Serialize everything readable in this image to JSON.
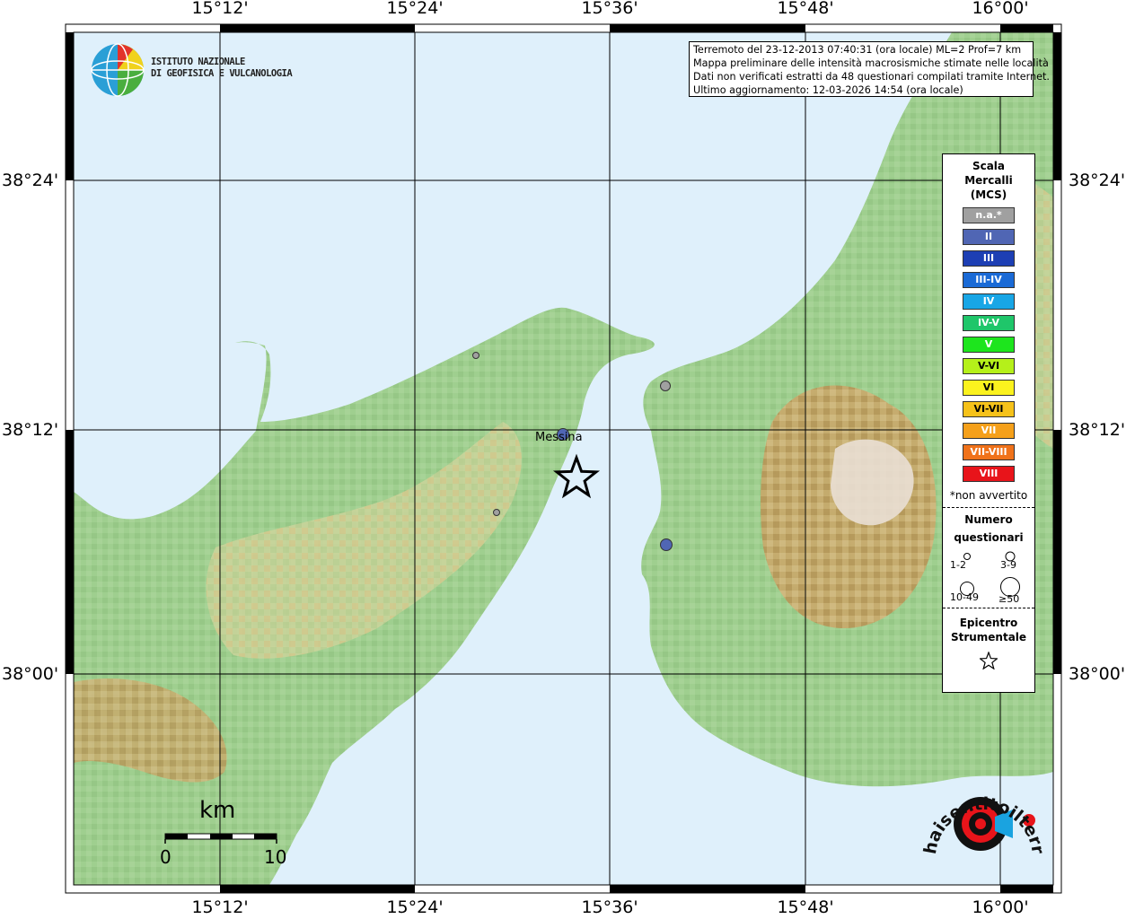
{
  "map": {
    "lon_labels": [
      "15°12'",
      "15°24'",
      "15°36'",
      "15°48'",
      "16°00'"
    ],
    "lat_labels": [
      "38°24'",
      "38°12'",
      "38°00'"
    ],
    "place_label": "Messina"
  },
  "logo": {
    "line1": "ISTITUTO NAZIONALE",
    "line2": "DI GEOFISICA E VULCANOLOGIA"
  },
  "info": {
    "line1": "Terremoto del 23-12-2013 07:40:31 (ora locale) ML=2 Prof=7 km",
    "line2": "Mappa preliminare delle intensità macrosismiche stimate nelle località",
    "line3": "Dati non verificati estratti da 48 questionari compilati tramite Internet.",
    "line4": "Ultimo aggiornamento: 12-03-2026 14:54 (ora locale)"
  },
  "legend": {
    "title": [
      "Scala",
      "Mercalli",
      "(MCS)"
    ],
    "scale": [
      {
        "label": "n.a.*",
        "color": "#a0a0a0"
      },
      {
        "label": "II",
        "color": "#5066b4"
      },
      {
        "label": "III",
        "color": "#1d3fb4"
      },
      {
        "label": "III-IV",
        "color": "#1a6ad6"
      },
      {
        "label": "IV",
        "color": "#18a6e6"
      },
      {
        "label": "IV-V",
        "color": "#1fc66a"
      },
      {
        "label": "V",
        "color": "#1de51d"
      },
      {
        "label": "V-VI",
        "color": "#b5f01a"
      },
      {
        "label": "VI",
        "color": "#fbf21e"
      },
      {
        "label": "VI-VII",
        "color": "#f6c21a"
      },
      {
        "label": "VII",
        "color": "#f5a01a"
      },
      {
        "label": "VII-VIII",
        "color": "#f0721a"
      },
      {
        "label": "VIII",
        "color": "#e8141a"
      }
    ],
    "not_felt_note": "*non avvertito",
    "count_title": [
      "Numero",
      "questionari"
    ],
    "count_labels": [
      "1-2",
      "3-9",
      "10-49",
      "≥50"
    ],
    "epicenter_title": [
      "Epicentro",
      "Strumentale"
    ]
  },
  "scalebar": {
    "unit": "km",
    "start": "0",
    "end": "10"
  },
  "observations": [
    {
      "intensity": "II",
      "questionnaires": "3-9"
    },
    {
      "intensity": "II",
      "questionnaires": "3-9"
    },
    {
      "intensity": "n.a.*",
      "questionnaires": "3-9"
    },
    {
      "intensity": "n.a.*",
      "questionnaires": "1-2"
    },
    {
      "intensity": "n.a.*",
      "questionnaires": "1-2"
    }
  ],
  "watermark": "haisentitoilterremoto.it"
}
